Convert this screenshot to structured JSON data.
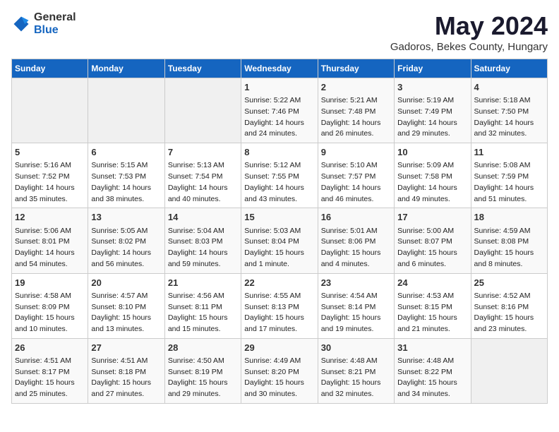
{
  "logo": {
    "general": "General",
    "blue": "Blue"
  },
  "title": "May 2024",
  "subtitle": "Gadoros, Bekes County, Hungary",
  "days_header": [
    "Sunday",
    "Monday",
    "Tuesday",
    "Wednesday",
    "Thursday",
    "Friday",
    "Saturday"
  ],
  "weeks": [
    [
      {
        "day": "",
        "info": ""
      },
      {
        "day": "",
        "info": ""
      },
      {
        "day": "",
        "info": ""
      },
      {
        "day": "1",
        "info": "Sunrise: 5:22 AM\nSunset: 7:46 PM\nDaylight: 14 hours\nand 24 minutes."
      },
      {
        "day": "2",
        "info": "Sunrise: 5:21 AM\nSunset: 7:48 PM\nDaylight: 14 hours\nand 26 minutes."
      },
      {
        "day": "3",
        "info": "Sunrise: 5:19 AM\nSunset: 7:49 PM\nDaylight: 14 hours\nand 29 minutes."
      },
      {
        "day": "4",
        "info": "Sunrise: 5:18 AM\nSunset: 7:50 PM\nDaylight: 14 hours\nand 32 minutes."
      }
    ],
    [
      {
        "day": "5",
        "info": "Sunrise: 5:16 AM\nSunset: 7:52 PM\nDaylight: 14 hours\nand 35 minutes."
      },
      {
        "day": "6",
        "info": "Sunrise: 5:15 AM\nSunset: 7:53 PM\nDaylight: 14 hours\nand 38 minutes."
      },
      {
        "day": "7",
        "info": "Sunrise: 5:13 AM\nSunset: 7:54 PM\nDaylight: 14 hours\nand 40 minutes."
      },
      {
        "day": "8",
        "info": "Sunrise: 5:12 AM\nSunset: 7:55 PM\nDaylight: 14 hours\nand 43 minutes."
      },
      {
        "day": "9",
        "info": "Sunrise: 5:10 AM\nSunset: 7:57 PM\nDaylight: 14 hours\nand 46 minutes."
      },
      {
        "day": "10",
        "info": "Sunrise: 5:09 AM\nSunset: 7:58 PM\nDaylight: 14 hours\nand 49 minutes."
      },
      {
        "day": "11",
        "info": "Sunrise: 5:08 AM\nSunset: 7:59 PM\nDaylight: 14 hours\nand 51 minutes."
      }
    ],
    [
      {
        "day": "12",
        "info": "Sunrise: 5:06 AM\nSunset: 8:01 PM\nDaylight: 14 hours\nand 54 minutes."
      },
      {
        "day": "13",
        "info": "Sunrise: 5:05 AM\nSunset: 8:02 PM\nDaylight: 14 hours\nand 56 minutes."
      },
      {
        "day": "14",
        "info": "Sunrise: 5:04 AM\nSunset: 8:03 PM\nDaylight: 14 hours\nand 59 minutes."
      },
      {
        "day": "15",
        "info": "Sunrise: 5:03 AM\nSunset: 8:04 PM\nDaylight: 15 hours\nand 1 minute."
      },
      {
        "day": "16",
        "info": "Sunrise: 5:01 AM\nSunset: 8:06 PM\nDaylight: 15 hours\nand 4 minutes."
      },
      {
        "day": "17",
        "info": "Sunrise: 5:00 AM\nSunset: 8:07 PM\nDaylight: 15 hours\nand 6 minutes."
      },
      {
        "day": "18",
        "info": "Sunrise: 4:59 AM\nSunset: 8:08 PM\nDaylight: 15 hours\nand 8 minutes."
      }
    ],
    [
      {
        "day": "19",
        "info": "Sunrise: 4:58 AM\nSunset: 8:09 PM\nDaylight: 15 hours\nand 10 minutes."
      },
      {
        "day": "20",
        "info": "Sunrise: 4:57 AM\nSunset: 8:10 PM\nDaylight: 15 hours\nand 13 minutes."
      },
      {
        "day": "21",
        "info": "Sunrise: 4:56 AM\nSunset: 8:11 PM\nDaylight: 15 hours\nand 15 minutes."
      },
      {
        "day": "22",
        "info": "Sunrise: 4:55 AM\nSunset: 8:13 PM\nDaylight: 15 hours\nand 17 minutes."
      },
      {
        "day": "23",
        "info": "Sunrise: 4:54 AM\nSunset: 8:14 PM\nDaylight: 15 hours\nand 19 minutes."
      },
      {
        "day": "24",
        "info": "Sunrise: 4:53 AM\nSunset: 8:15 PM\nDaylight: 15 hours\nand 21 minutes."
      },
      {
        "day": "25",
        "info": "Sunrise: 4:52 AM\nSunset: 8:16 PM\nDaylight: 15 hours\nand 23 minutes."
      }
    ],
    [
      {
        "day": "26",
        "info": "Sunrise: 4:51 AM\nSunset: 8:17 PM\nDaylight: 15 hours\nand 25 minutes."
      },
      {
        "day": "27",
        "info": "Sunrise: 4:51 AM\nSunset: 8:18 PM\nDaylight: 15 hours\nand 27 minutes."
      },
      {
        "day": "28",
        "info": "Sunrise: 4:50 AM\nSunset: 8:19 PM\nDaylight: 15 hours\nand 29 minutes."
      },
      {
        "day": "29",
        "info": "Sunrise: 4:49 AM\nSunset: 8:20 PM\nDaylight: 15 hours\nand 30 minutes."
      },
      {
        "day": "30",
        "info": "Sunrise: 4:48 AM\nSunset: 8:21 PM\nDaylight: 15 hours\nand 32 minutes."
      },
      {
        "day": "31",
        "info": "Sunrise: 4:48 AM\nSunset: 8:22 PM\nDaylight: 15 hours\nand 34 minutes."
      },
      {
        "day": "",
        "info": ""
      }
    ]
  ]
}
